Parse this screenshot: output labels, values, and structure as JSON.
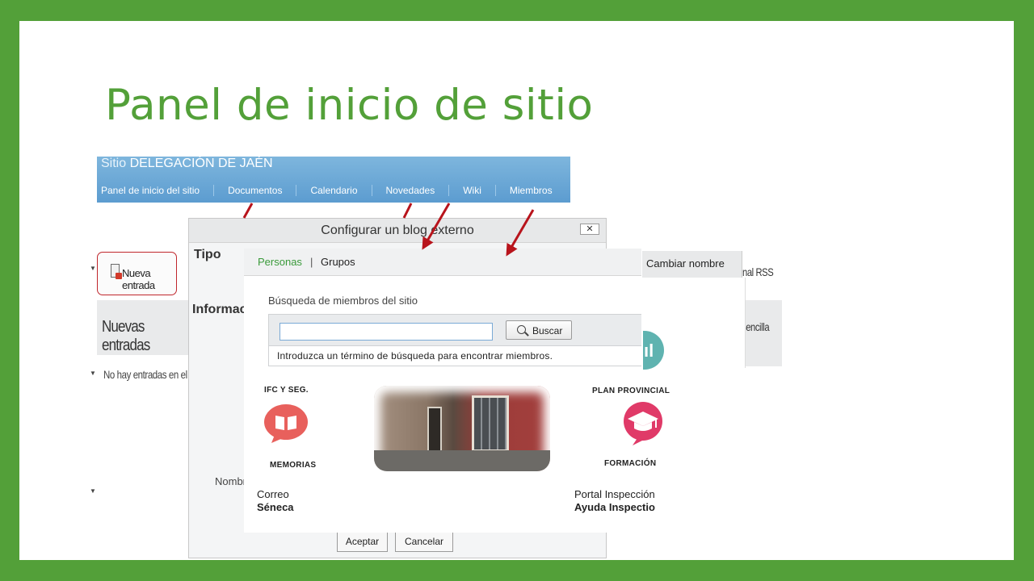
{
  "slide": {
    "title": "Panel de inicio de sitio"
  },
  "site_header": {
    "prefix": "Sitio",
    "name": "DELEGACIÓN DE JAÉN",
    "nav": [
      {
        "label": "Panel de inicio del sitio"
      },
      {
        "label": "Documentos"
      },
      {
        "label": "Calendario"
      },
      {
        "label": "Novedades"
      },
      {
        "label": "Wiki"
      },
      {
        "label": "Miembros"
      }
    ]
  },
  "blog_panel": {
    "new_entry_label": "Nueva entrada",
    "section_title": "Nuevas entradas",
    "empty_text": "No hay entradas en el blog"
  },
  "right_panel": {
    "rss": "nal RSS",
    "sencilla": "sencilla",
    "rename": "Cambiar nombre"
  },
  "blog_dialog": {
    "title": "Configurar un blog externo",
    "close": "✕",
    "tipo": "Tipo",
    "informacion": "Informac",
    "nombre": "Nombr",
    "accept": "Aceptar",
    "cancel": "Cancelar"
  },
  "members_dialog": {
    "tab_personas": "Personas",
    "tab_separator": "|",
    "tab_grupos": "Grupos",
    "search_heading": "Búsqueda de miembros del sitio",
    "search_value": "",
    "search_button": "Buscar",
    "hint": "Introduzca un término de búsqueda para encontrar miembros."
  },
  "portal": {
    "ifc": "IFC Y SEG.",
    "memorias": "MEMORIAS",
    "plan": "PLAN PROVINCIAL",
    "formacion": "FORMACIÓN",
    "teal_glyph": "ıl",
    "correo": "Correo",
    "seneca": "Séneca",
    "portal_insp": "Portal Inspección",
    "ayuda": "Ayuda Inspectio"
  },
  "colors": {
    "background": "#53a039",
    "title": "#53a039",
    "header_blue": "#5c9cd0",
    "arrow_red": "#b8141c",
    "highlight_red": "#c0262c",
    "speech_red": "#e8605c",
    "grad_pink": "#e03a68",
    "teal": "#5fb3b0"
  },
  "icons": [
    "new-entry-icon",
    "search-icon",
    "close-icon",
    "speech-bubble-icon",
    "graduation-cap-icon",
    "arrow-icon"
  ]
}
